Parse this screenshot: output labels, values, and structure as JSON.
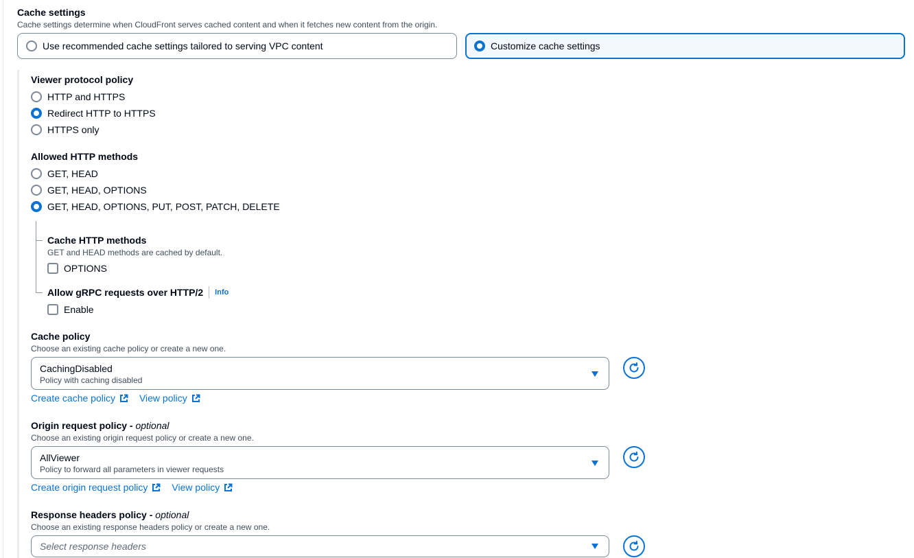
{
  "cache_settings": {
    "title": "Cache settings",
    "description": "Cache settings determine when CloudFront serves cached content and when it fetches new content from the origin.",
    "options": [
      {
        "label": "Use recommended cache settings tailored to serving VPC content",
        "selected": false
      },
      {
        "label": "Customize cache settings",
        "selected": true
      }
    ]
  },
  "viewer_protocol": {
    "title": "Viewer protocol policy",
    "options": [
      {
        "label": "HTTP and HTTPS",
        "selected": false
      },
      {
        "label": "Redirect HTTP to HTTPS",
        "selected": true
      },
      {
        "label": "HTTPS only",
        "selected": false
      }
    ]
  },
  "allowed_methods": {
    "title": "Allowed HTTP methods",
    "options": [
      {
        "label": "GET, HEAD",
        "selected": false
      },
      {
        "label": "GET, HEAD, OPTIONS",
        "selected": false
      },
      {
        "label": "GET, HEAD, OPTIONS, PUT, POST, PATCH, DELETE",
        "selected": true
      }
    ]
  },
  "cache_http_methods": {
    "title": "Cache HTTP methods",
    "description": "GET and HEAD methods are cached by default.",
    "checkbox_label": "OPTIONS",
    "checked": false
  },
  "grpc": {
    "title": "Allow gRPC requests over HTTP/2",
    "info": "Info",
    "checkbox_label": "Enable",
    "checked": false
  },
  "cache_policy": {
    "title": "Cache policy",
    "description": "Choose an existing cache policy or create a new one.",
    "selected_value": "CachingDisabled",
    "selected_description": "Policy with caching disabled",
    "create_link": "Create cache policy",
    "view_link": "View policy"
  },
  "origin_request_policy": {
    "title": "Origin request policy - ",
    "title_optional": "optional",
    "description": "Choose an existing origin request policy or create a new one.",
    "selected_value": "AllViewer",
    "selected_description": "Policy to forward all parameters in viewer requests",
    "create_link": "Create origin request policy",
    "view_link": "View policy"
  },
  "response_headers_policy": {
    "title": "Response headers policy - ",
    "title_optional": "optional",
    "description": "Choose an existing response headers policy or create a new one.",
    "placeholder": "Select response headers"
  },
  "colors": {
    "accent": "#0972d3",
    "border": "#7d8998",
    "selected_tile_bg": "#f2f8fd",
    "text": "#000716",
    "muted": "#414d5c"
  }
}
